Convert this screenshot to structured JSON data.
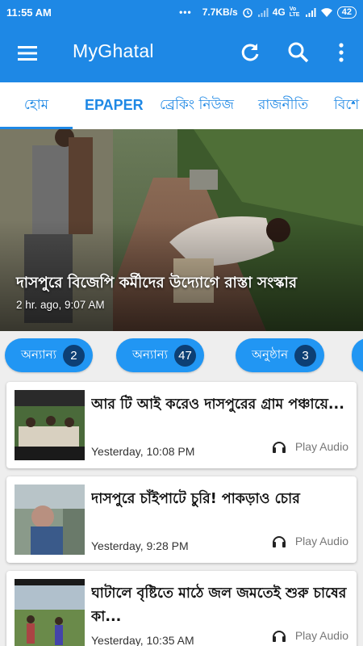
{
  "status": {
    "time": "11:55 AM",
    "speed": "7.7KB/s",
    "network": "4G",
    "volte": "Vo LTE",
    "battery": "42"
  },
  "appbar": {
    "title": "MyGhatal"
  },
  "tabs": [
    {
      "label": "হোম"
    },
    {
      "label": "EPAPER"
    },
    {
      "label": "ব্রেকিং নিউজ"
    },
    {
      "label": "রাজনীতি"
    },
    {
      "label": "বিশে"
    }
  ],
  "hero": {
    "headline": "দাসপুরে বিজেপি কর্মীদের উদ্যোগে রাস্তা সংস্কার",
    "time": "2 hr. ago, 9:07 AM"
  },
  "chips": [
    {
      "label": "অন্যান্য",
      "count": "2"
    },
    {
      "label": "অন্যান্য",
      "count": "47"
    },
    {
      "label": "অনুষ্ঠান",
      "count": "3"
    }
  ],
  "articles": [
    {
      "title": "আর টি আই করেও দাসপুরের গ্রাম পঞ্চায়ে...",
      "time": "Yesterday, 10:08 PM",
      "audio_label": "Play Audio"
    },
    {
      "title": "দাসপুরে চাঁইপাটে চুরি! পাকড়াও চোর",
      "time": "Yesterday, 9:28 PM",
      "audio_label": "Play Audio"
    },
    {
      "title": "ঘাটালে বৃষ্টিতে মাঠে জল জমতেই শুরু চাষের কা...",
      "time": "Yesterday, 10:35 AM",
      "audio_label": "Play Audio"
    }
  ],
  "colors": {
    "primary": "#1e88e5",
    "chip": "#2196f3",
    "chip_count": "#0d3f74"
  }
}
